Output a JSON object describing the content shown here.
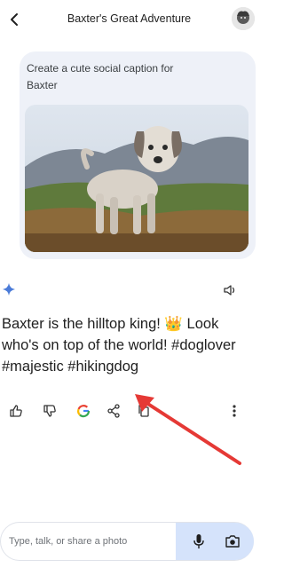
{
  "header": {
    "title": "Baxter's Great Adventure",
    "back_icon": "back-arrow-icon",
    "avatar_icon": "avatar"
  },
  "prompt": {
    "text": "Create a cute social caption for Baxter",
    "image_description_icon": "dog-photo"
  },
  "response": {
    "text": "Baxter is the hilltop king! 👑 Look who's on top of the world! #doglover #majestic #hikingdog",
    "sparkle_icon": "sparkle-icon",
    "speaker_icon": "speaker-icon"
  },
  "actions": [
    {
      "name": "thumbs-up-icon"
    },
    {
      "name": "thumbs-down-icon"
    },
    {
      "name": "google-search-icon",
      "label": "G"
    },
    {
      "name": "share-icon"
    },
    {
      "name": "copy-icon"
    },
    {
      "name": "more-options-icon"
    }
  ],
  "input": {
    "placeholder": "Type, talk, or share a photo",
    "mic_icon": "mic-icon",
    "camera_icon": "camera-icon"
  },
  "colors": {
    "prompt_card_bg": "#eef1f8",
    "input_action_bg": "#d5e3fb",
    "annotation_arrow": "#e53935",
    "google_blue": "#4285f4",
    "sparkle_blue": "#4a7bd8"
  }
}
